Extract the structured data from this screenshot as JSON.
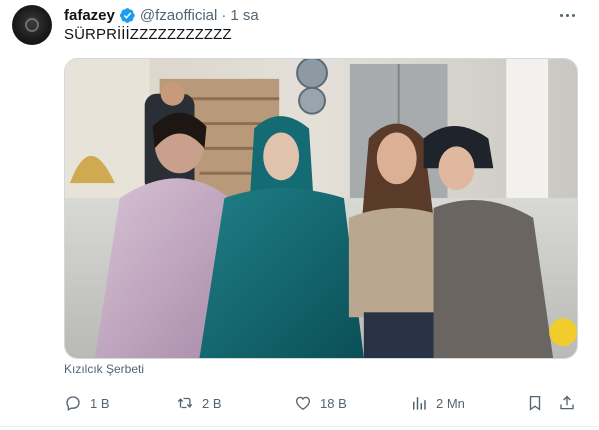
{
  "tweet": {
    "author_name": "fafazey",
    "author_handle": "@fzaofficial",
    "separator": "·",
    "time": "1 sa",
    "text": "SÜRPRİİİZZZZZZZZZZZ",
    "media_caption": "Kızılcık Şerbeti"
  },
  "actions": {
    "reply_count": "1 B",
    "retweet_count": "2 B",
    "like_count": "18 B",
    "views_count": "2 Mn"
  },
  "icons": {
    "avatar": "profile-avatar",
    "verified": "verified-badge-icon",
    "more": "more-options-icon",
    "reply": "reply-icon",
    "retweet": "retweet-icon",
    "like": "heart-icon",
    "views": "views-chart-icon",
    "bookmark": "bookmark-icon",
    "share": "share-icon"
  },
  "colors": {
    "verified": "#1d9bf0",
    "secondary_text": "#536471",
    "primary_text": "#0f1419"
  }
}
